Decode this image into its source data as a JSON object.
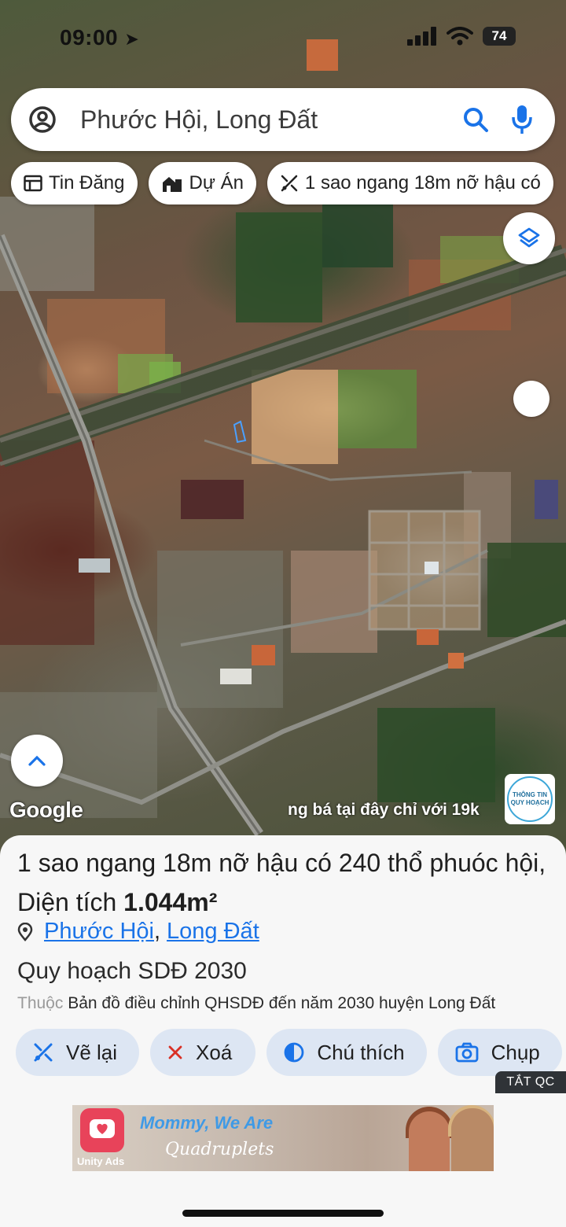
{
  "status_bar": {
    "time": "09:00",
    "battery": "74"
  },
  "search": {
    "query": "Phước Hội, Long Đất"
  },
  "chips": [
    {
      "label": "Tin Đăng",
      "icon": "listing-icon"
    },
    {
      "label": "Dự Án",
      "icon": "building-icon"
    },
    {
      "label": "1 sao ngang 18m nỡ hậu có",
      "icon": "draw-icon"
    }
  ],
  "map": {
    "watermark": "Google",
    "ticker": "ng bá tại đây chỉ với 19k",
    "info_badge_line1": "THÔNG TIN",
    "info_badge_line2": "QUY HOẠCH"
  },
  "sheet": {
    "title_part1": "1 sao ngang 18m nỡ hậu có 240 thổ phuóc hội",
    "title_part2": ", Diện tích ",
    "title_area": "1.044m²",
    "location_1": "Phước Hội",
    "location_2": "Long Đất",
    "plan_title": "Quy hoạch SDĐ 2030",
    "plan_prefix": "Thuộc ",
    "plan_desc": "Bản đồ điều chỉnh QHSDĐ đến năm 2030 huyện Long Đất"
  },
  "actions": [
    {
      "label": "Vẽ lại",
      "icon": "redraw-icon"
    },
    {
      "label": "Xoá",
      "icon": "close-icon"
    },
    {
      "label": "Chú thích",
      "icon": "contrast-icon"
    },
    {
      "label": "Chụp",
      "icon": "camera-icon"
    }
  ],
  "ad": {
    "close_label": "TẮT QC",
    "title": "Mommy, We Are",
    "subtitle": "Quadruplets",
    "network": "Unity Ads"
  },
  "colors": {
    "accent": "#1a73e8",
    "action_bg": "#dde6f3",
    "close_x": "#d93025"
  }
}
